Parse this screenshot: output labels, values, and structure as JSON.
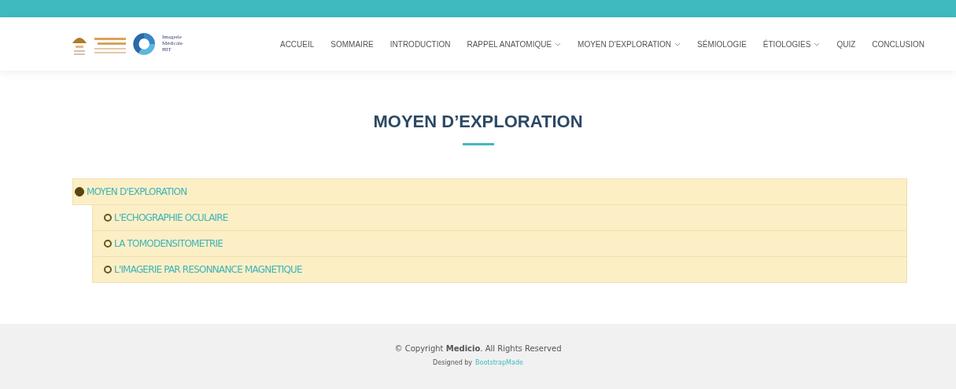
{
  "logo": {
    "lines": [
      "Imagerie",
      "Médicale",
      "HIT"
    ]
  },
  "nav": [
    {
      "label": "ACCUEIL",
      "dropdown": false
    },
    {
      "label": "SOMMAIRE",
      "dropdown": false
    },
    {
      "label": "INTRODUCTION",
      "dropdown": false
    },
    {
      "label": "RAPPEL ANATOMIQUE",
      "dropdown": true
    },
    {
      "label": "MOYEN D'EXPLORATION",
      "dropdown": true
    },
    {
      "label": "SÉMIOLOGIE",
      "dropdown": false
    },
    {
      "label": "ÉTIOLOGIES",
      "dropdown": true
    },
    {
      "label": "QUIZ",
      "dropdown": false
    },
    {
      "label": "CONCLUSION",
      "dropdown": false
    }
  ],
  "section": {
    "title": "MOYEN D’EXPLORATION"
  },
  "tree": [
    {
      "label": "MOYEN D'EXPLORATION",
      "expanded": true,
      "children": [
        {
          "label": "L'ECHOGRAPHIE OCULAIRE",
          "expanded": false
        },
        {
          "label": "LA TOMODENSITOMETRIE",
          "expanded": false
        },
        {
          "label": "L'IMAGERIE PAR RESONNANCE MAGNETIQUE",
          "expanded": false
        }
      ]
    }
  ],
  "footer": {
    "copyright": "© Copyright **Medicio**. All Rights Reserved",
    "designed_by": "Designed by",
    "designer_link": "BootstrapMade"
  }
}
